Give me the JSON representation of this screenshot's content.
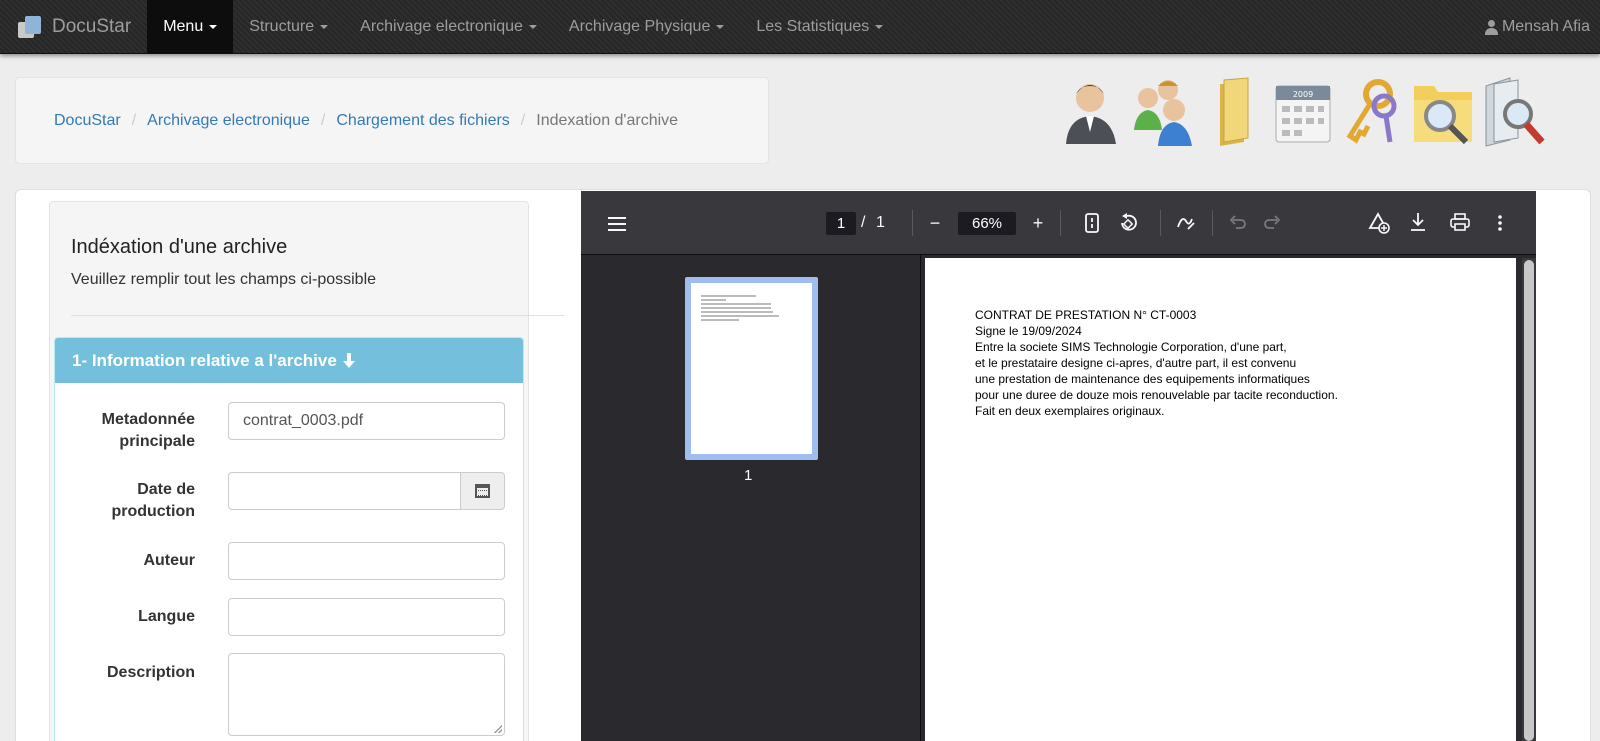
{
  "navbar": {
    "brand": "DocuStar",
    "items": [
      {
        "label": "Menu"
      },
      {
        "label": "Structure"
      },
      {
        "label": "Archivage electronique"
      },
      {
        "label": "Archivage Physique"
      },
      {
        "label": "Les Statistiques"
      }
    ],
    "user": "Mensah Afia"
  },
  "breadcrumb": {
    "items": [
      "DocuStar",
      "Archivage electronique",
      "Chargement des fichiers"
    ],
    "active": "Indexation d'archive"
  },
  "toolbar_icons": [
    "user-icon",
    "users-group-icon",
    "folder-icon",
    "calendar-icon",
    "keys-icon",
    "folder-search-icon",
    "document-search-icon"
  ],
  "form": {
    "title": "Indéxation d'une archive",
    "subtitle": "Veuillez remplir tout les champs ci-possible",
    "panel_title": "1- Information relative a l'archive",
    "fields": {
      "metadata": {
        "label_1": "Metadonnée",
        "label_2": "principale",
        "value": "contrat_0003.pdf"
      },
      "date": {
        "label_1": "Date de",
        "label_2": "production",
        "value": ""
      },
      "author": {
        "label": "Auteur",
        "value": ""
      },
      "language": {
        "label": "Langue",
        "value": ""
      },
      "description": {
        "label": "Description",
        "value": ""
      }
    }
  },
  "pdf_viewer": {
    "current_page": "1",
    "page_separator": "/",
    "total_pages": "1",
    "zoom": "66%",
    "thumbnail_label": "1",
    "document_lines": [
      "CONTRAT DE PRESTATION N° CT-0003",
      "Signe le 19/09/2024",
      "Entre la societe SIMS Technologie Corporation, d'une part,",
      "et le prestataire designe ci-apres, d'autre part, il est convenu",
      "une prestation de maintenance des equipements informatiques",
      "pour une duree de douze mois renouvelable par tacite reconduction.",
      "Fait en deux exemplaires originaux."
    ]
  },
  "colors": {
    "navbar_bg": "#2b2b2b",
    "link": "#337ab7",
    "panel_header": "#74bfdb",
    "viewer_toolbar": "#38383d",
    "viewer_bg": "#2a2a2e",
    "thumb_highlight": "#a0bdf2"
  }
}
